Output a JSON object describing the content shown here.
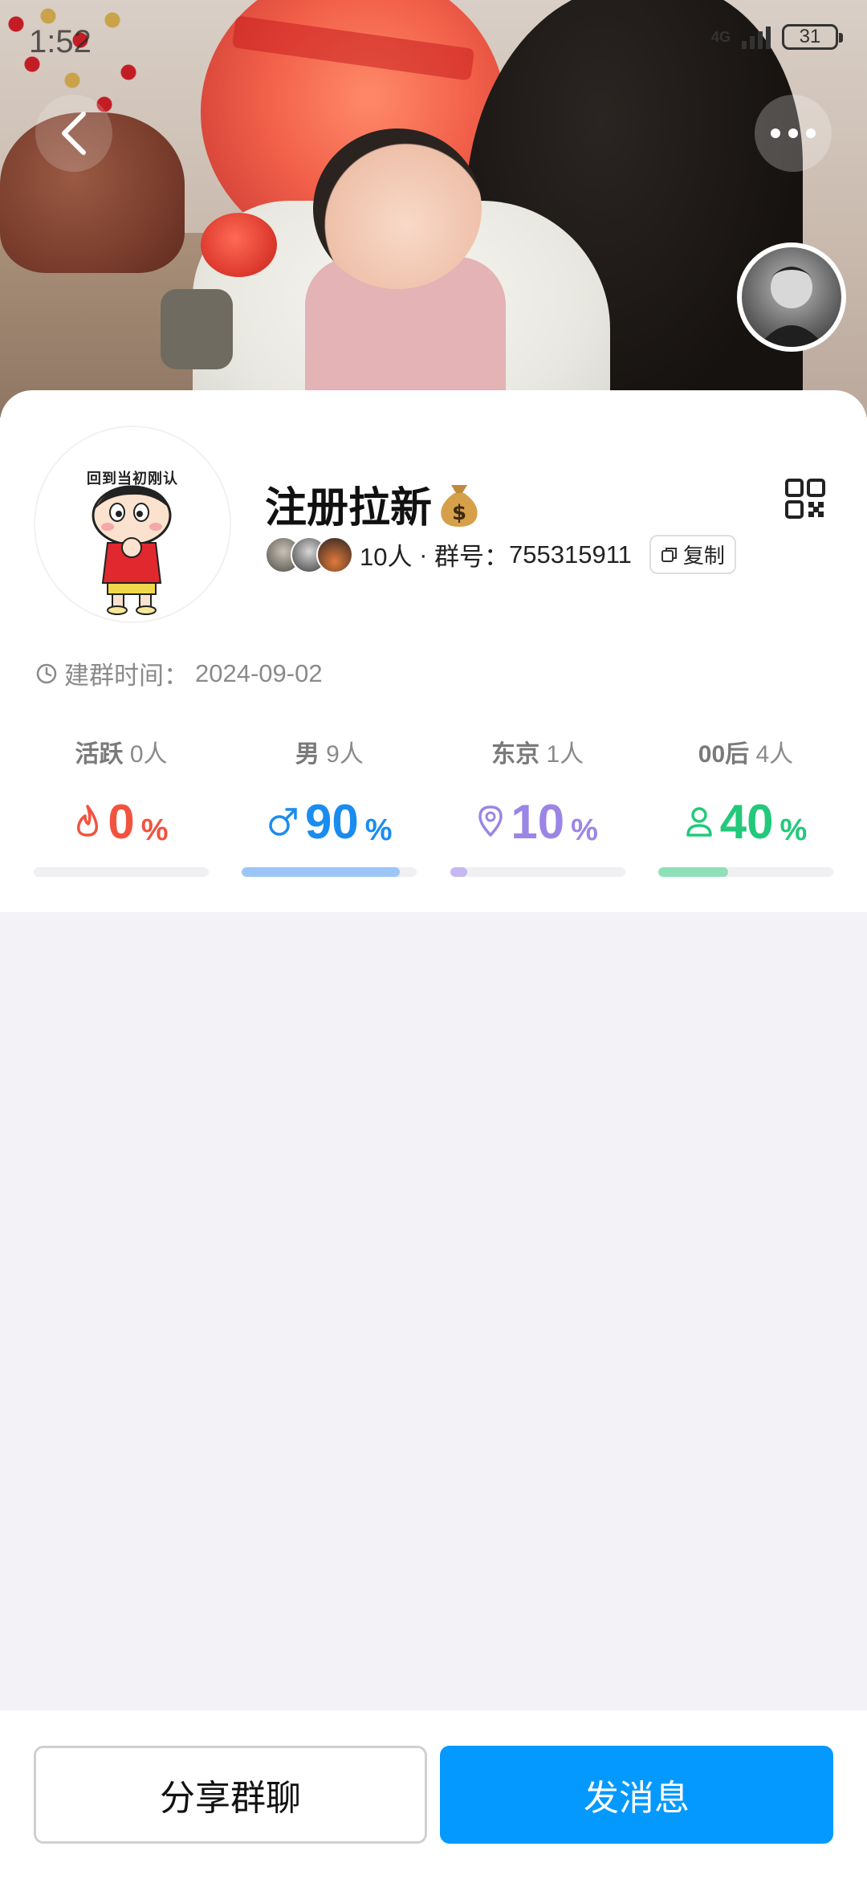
{
  "status_bar": {
    "time": "1:52",
    "network": "4G",
    "battery": "31"
  },
  "header": {
    "back_icon": "chevron-left-icon",
    "more_icon": "more-horizontal-icon"
  },
  "group": {
    "avatar_caption": "回到当初刚认",
    "name": "注册拉新",
    "name_emoji_icon": "money-bag-icon",
    "member_count": "10人",
    "separator": " · ",
    "group_id_label": "群号：",
    "group_id": "755315911",
    "copy_label": "复制",
    "created_label": "建群时间：",
    "created_date": "2024-09-02"
  },
  "stats": [
    {
      "label": "活跃",
      "count": "0人",
      "value": "0",
      "unit": "%",
      "fraction": 0.0,
      "color": "#f2533f",
      "icon": "flame-icon"
    },
    {
      "label": "男",
      "count": "9人",
      "value": "90",
      "unit": "%",
      "fraction": 0.9,
      "color": "#1a8cf0",
      "bar_color": "#9cc6f5",
      "icon": "male-icon"
    },
    {
      "label": "东京",
      "count": "1人",
      "value": "10",
      "unit": "%",
      "fraction": 0.1,
      "color": "#9b86e6",
      "bar_color": "#c6b8f2",
      "icon": "location-pin-icon"
    },
    {
      "label": "00后",
      "count": "4人",
      "value": "40",
      "unit": "%",
      "fraction": 0.4,
      "color": "#22c97a",
      "bar_color": "#8fe0b9",
      "icon": "person-icon"
    }
  ],
  "actions": {
    "share_label": "分享群聊",
    "send_label": "发消息"
  },
  "colors": {
    "primary": "#0499ff",
    "background": "#f2f2f7"
  }
}
